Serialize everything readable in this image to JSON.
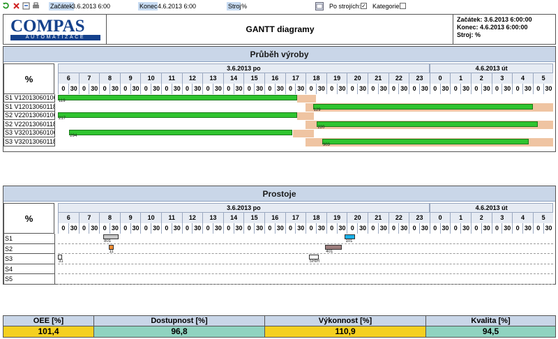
{
  "toolbar": {
    "start_label": "Začátek",
    "start_value": "3.6.2013 6:00",
    "end_label": "Konec",
    "end_value": "4.6.2013 6:00",
    "machine_label": "Stroj",
    "machine_value": "%",
    "by_machine_label": "Po strojích:",
    "by_machine_checked": "✓",
    "category_label": "Kategorie"
  },
  "header": {
    "logo_main": "COMPAS",
    "logo_sub": "AUTOMATIZACE",
    "title": "GANTT diagramy",
    "info_start": "Začátek: 3.6.2013 6:00:00",
    "info_end": "Konec: 4.6.2013 6:00:00",
    "info_machine": "Stroj: %"
  },
  "timeline": {
    "pct_label": "%",
    "date1": "3.6.2013 po",
    "date2": "4.6.2013 út",
    "hours": [
      "6",
      "7",
      "8",
      "9",
      "10",
      "11",
      "12",
      "13",
      "14",
      "15",
      "16",
      "17",
      "18",
      "19",
      "20",
      "21",
      "22",
      "23",
      "0",
      "1",
      "2",
      "3",
      "4",
      "5"
    ],
    "minutes": [
      "0",
      "30"
    ]
  },
  "production": {
    "title": "Průběh výroby",
    "rows": [
      {
        "label": "S1 V12013060106",
        "bar_start": 6.0,
        "bar_end": 17.6,
        "bar_label": "119",
        "shade_start": 17.6,
        "shade_end": 18.5
      },
      {
        "label": "S1 V12013060118",
        "bar_start": 18.35,
        "bar_end": 5.0,
        "bar_label": "129",
        "shade_start": 18.0,
        "shade_end": 6.0
      },
      {
        "label": "S2 V22013060106",
        "bar_start": 6.0,
        "bar_end": 17.6,
        "bar_label": "217",
        "shade_start": 17.6,
        "shade_end": 18.4
      },
      {
        "label": "S2 V22013060118",
        "bar_start": 18.55,
        "bar_end": 5.25,
        "bar_label": "220",
        "shade_start": 18.0,
        "shade_end": 6.0
      },
      {
        "label": "S3 V32013060106",
        "bar_start": 6.55,
        "bar_end": 17.35,
        "bar_label": "294",
        "shade_start": 17.4,
        "shade_end": 18.4
      },
      {
        "label": "S3 V32013060118",
        "bar_start": 18.8,
        "bar_end": 4.8,
        "bar_label": "303",
        "shade_start": 18.0,
        "shade_end": 6.0
      }
    ]
  },
  "downtime": {
    "title": "Prostoje",
    "rows": [
      {
        "label": "S1",
        "events": [
          {
            "start": 8.2,
            "end": 8.95,
            "color": "#c8c8c8",
            "label": "801"
          },
          {
            "start": 19.9,
            "end": 20.4,
            "color": "#1ab0e8",
            "label": "101"
          }
        ]
      },
      {
        "label": "S2",
        "events": [
          {
            "start": 8.45,
            "end": 8.7,
            "color": "#f08a30",
            "label": "11"
          },
          {
            "start": 18.95,
            "end": 19.75,
            "color": "#9c7c7c",
            "label": "401"
          }
        ]
      },
      {
        "label": "S3",
        "events": [
          {
            "start": 6.0,
            "end": 6.2,
            "color": "#ffffff",
            "label": "31"
          },
          {
            "start": 18.15,
            "end": 18.65,
            "color": "#ffffff",
            "label": "SHIH"
          }
        ]
      },
      {
        "label": "S4",
        "events": []
      },
      {
        "label": "S5",
        "events": []
      }
    ]
  },
  "metrics": [
    {
      "label": "OEE [%]",
      "value": "101,4",
      "color": "#f5d020"
    },
    {
      "label": "Dostupnost [%]",
      "value": "96,8",
      "color": "#8fd3c0"
    },
    {
      "label": "Výkonnost [%]",
      "value": "110,9",
      "color": "#f5d020"
    },
    {
      "label": "Kvalita [%]",
      "value": "94,5",
      "color": "#8fd3c0"
    }
  ],
  "colors": {
    "bar_green": "#2fc42f",
    "shade": "#efc4a2",
    "metric_label_bg": "#c9d6e8"
  }
}
